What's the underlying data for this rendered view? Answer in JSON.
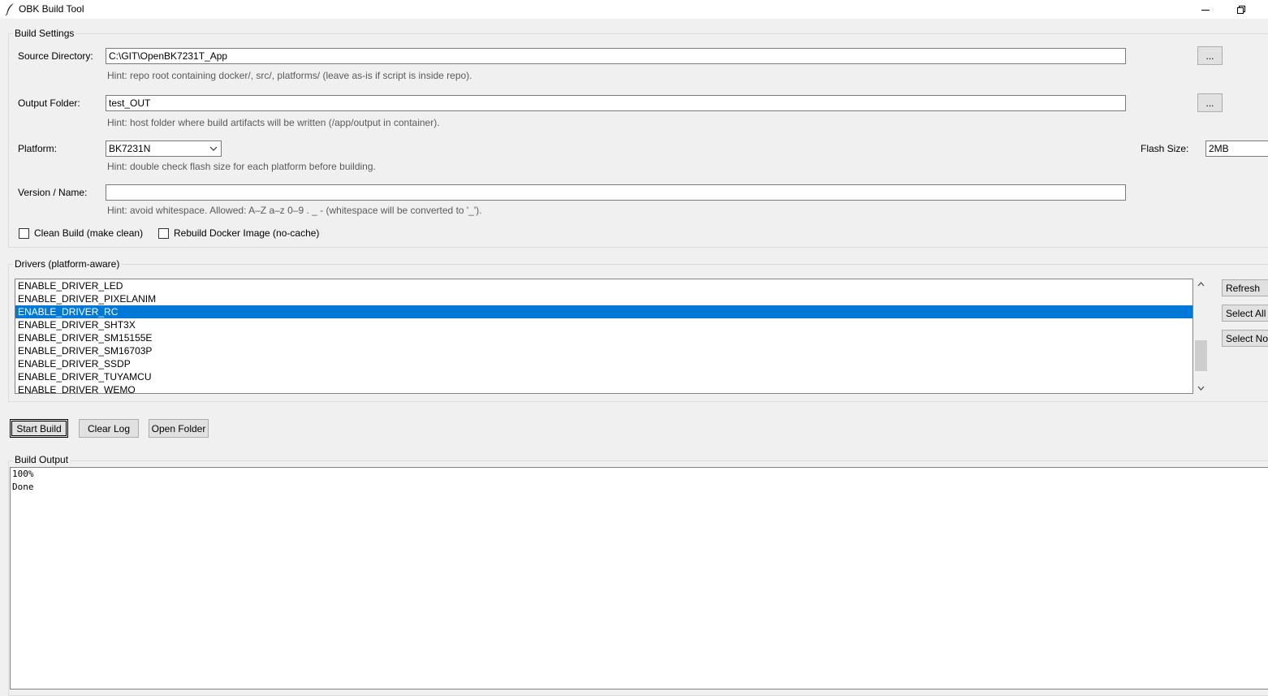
{
  "window": {
    "title": "OBK Build Tool",
    "icon": "feather-icon"
  },
  "build_settings": {
    "label": "Build Settings",
    "source_dir": {
      "label": "Source Directory:",
      "value": "C:\\GIT\\OpenBK7231T_App",
      "browse": "...",
      "hint": "Hint: repo root containing docker/, src/, platforms/ (leave as-is if script is inside repo)."
    },
    "output_folder": {
      "label": "Output Folder:",
      "value": "test_OUT",
      "browse": "...",
      "hint": "Hint: host folder where build artifacts will be written (/app/output in container)."
    },
    "platform": {
      "label": "Platform:",
      "value": "BK7231N",
      "hint": "Hint: double check flash size for each platform before building."
    },
    "flash_size": {
      "label": "Flash Size:",
      "value": "2MB"
    },
    "version": {
      "label": "Version / Name:",
      "value": "",
      "hint": "Hint: avoid whitespace. Allowed: A–Z a–z 0–9 . _ - (whitespace will be converted to '_')."
    },
    "clean_build": {
      "label": "Clean Build (make clean)",
      "checked": false
    },
    "rebuild_docker": {
      "label": "Rebuild Docker Image (no-cache)",
      "checked": false
    }
  },
  "drivers": {
    "label": "Drivers (platform-aware)",
    "items": [
      "ENABLE_DRIVER_LED",
      "ENABLE_DRIVER_PIXELANIM",
      "ENABLE_DRIVER_RC",
      "ENABLE_DRIVER_SHT3X",
      "ENABLE_DRIVER_SM15155E",
      "ENABLE_DRIVER_SM16703P",
      "ENABLE_DRIVER_SSDP",
      "ENABLE_DRIVER_TUYAMCU",
      "ENABLE_DRIVER_WEMO"
    ],
    "selected": "ENABLE_DRIVER_RC",
    "refresh": "Refresh",
    "select_all": "Select All",
    "select_none": "Select None"
  },
  "actions": {
    "start_build": "Start Build",
    "clear_log": "Clear Log",
    "open_folder": "Open Folder"
  },
  "output": {
    "label": "Build Output",
    "lines": [
      "100%",
      "Done"
    ]
  },
  "colors": {
    "selection": "#0078d7",
    "window_bg": "#f0f0f0"
  }
}
